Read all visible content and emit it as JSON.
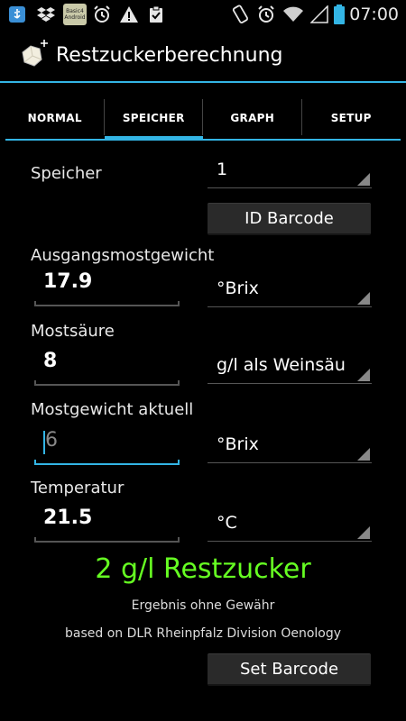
{
  "status": {
    "time": "07:00",
    "icons": [
      "usb-icon",
      "dropbox-icon",
      "basic4android-icon",
      "alarm-icon",
      "warning-icon",
      "clipboard-icon",
      "rotate-icon",
      "alarm-icon",
      "wifi-icon",
      "signal-icon",
      "battery-icon"
    ],
    "basic4android_label": "Basic4 Android"
  },
  "app": {
    "title": "Restzuckerberechnung",
    "icon": "sugar-cube-icon",
    "accent": "#33b5e5"
  },
  "tabs": [
    {
      "label": "NORMAL",
      "active": false
    },
    {
      "label": "SPEICHER",
      "active": true
    },
    {
      "label": "GRAPH",
      "active": false
    },
    {
      "label": "SETUP",
      "active": false
    }
  ],
  "form": {
    "speicher": {
      "label": "Speicher",
      "value": "1"
    },
    "id_barcode": "ID Barcode",
    "ausgangsmostgewicht": {
      "label": "Ausgangsmostgewicht",
      "value": "17.9",
      "unit": "°Brix"
    },
    "mostsaeure": {
      "label": "Mostsäure",
      "value": "8",
      "unit": "g/l als Weinsäure"
    },
    "mostgewicht_aktuell": {
      "label": "Mostgewicht aktuell",
      "value": "6",
      "unit": "°Brix"
    },
    "temperatur": {
      "label": "Temperatur",
      "value": "21.5",
      "unit": "°C"
    }
  },
  "result": {
    "text": "2 g/l Restzucker",
    "color": "#66ff22"
  },
  "disclaimer": "Ergebnis ohne Gewähr",
  "credit": "based on DLR Rheinpfalz Division Oenology",
  "set_barcode": "Set Barcode"
}
